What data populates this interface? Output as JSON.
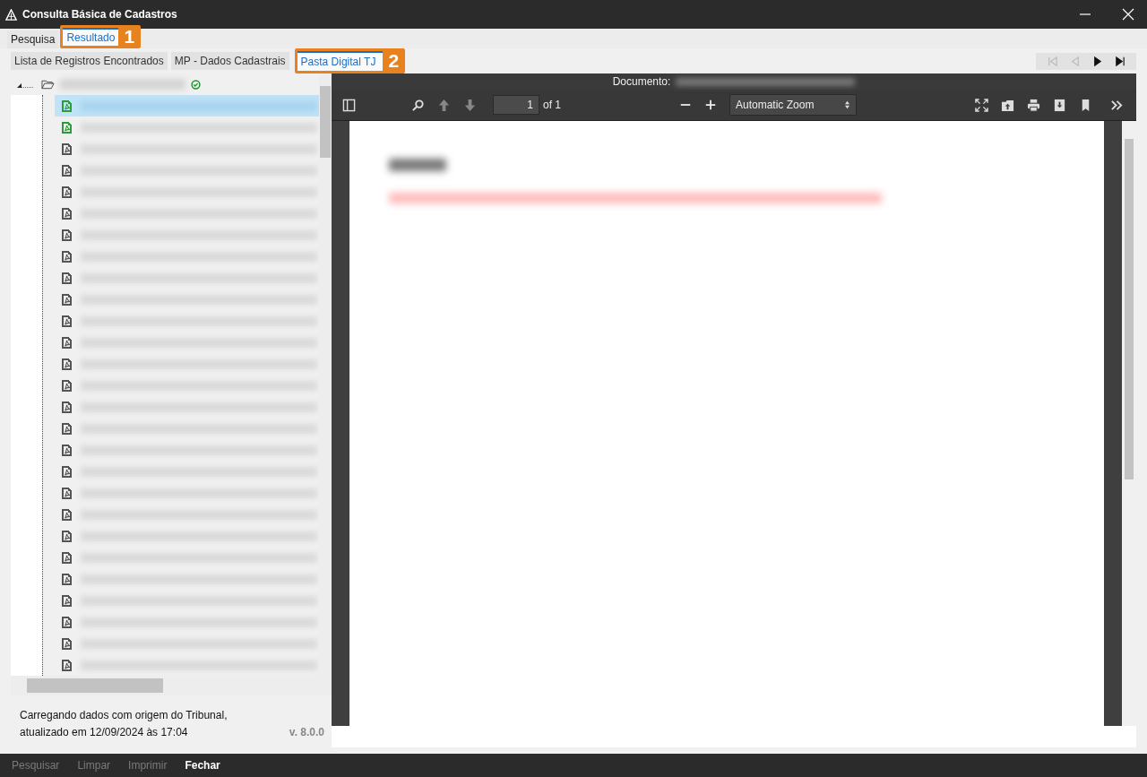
{
  "window": {
    "title": "Consulta Básica de Cadastros"
  },
  "main_tabs": [
    {
      "label": "Pesquisa",
      "selected": false
    },
    {
      "label": "Resultado",
      "selected": true,
      "callout": "1"
    }
  ],
  "sub_tabs": [
    {
      "label": "Lista de Registros Encontrados",
      "selected": false
    },
    {
      "label": "MP - Dados Cadastrais",
      "selected": false
    },
    {
      "label": "Pasta Digital TJ",
      "selected": true,
      "callout": "2"
    }
  ],
  "record_nav": [
    {
      "kind": "first",
      "disabled": true
    },
    {
      "kind": "prev",
      "disabled": true
    },
    {
      "kind": "next",
      "disabled": false
    },
    {
      "kind": "last",
      "disabled": false
    }
  ],
  "tree": {
    "items": [
      {
        "color": "#2e9a3e",
        "selected": true
      },
      {
        "color": "#2e9a3e",
        "selected": false
      },
      {
        "color": "#555555",
        "selected": false
      },
      {
        "color": "#555555",
        "selected": false
      },
      {
        "color": "#555555",
        "selected": false
      },
      {
        "color": "#555555",
        "selected": false
      },
      {
        "color": "#555555",
        "selected": false
      },
      {
        "color": "#555555",
        "selected": false
      },
      {
        "color": "#555555",
        "selected": false
      },
      {
        "color": "#555555",
        "selected": false
      },
      {
        "color": "#555555",
        "selected": false
      },
      {
        "color": "#555555",
        "selected": false
      },
      {
        "color": "#555555",
        "selected": false
      },
      {
        "color": "#555555",
        "selected": false
      },
      {
        "color": "#555555",
        "selected": false
      },
      {
        "color": "#555555",
        "selected": false
      },
      {
        "color": "#555555",
        "selected": false
      },
      {
        "color": "#555555",
        "selected": false
      },
      {
        "color": "#555555",
        "selected": false
      },
      {
        "color": "#555555",
        "selected": false
      },
      {
        "color": "#555555",
        "selected": false
      },
      {
        "color": "#555555",
        "selected": false
      },
      {
        "color": "#555555",
        "selected": false
      },
      {
        "color": "#555555",
        "selected": false
      },
      {
        "color": "#555555",
        "selected": false
      },
      {
        "color": "#555555",
        "selected": false
      },
      {
        "color": "#555555",
        "selected": false
      }
    ]
  },
  "status": {
    "lines": [
      "Carregando dados com origem do Tribunal,",
      "atualizado em 12/09/2024 às 17:04"
    ],
    "version": "v. 8.0.0"
  },
  "viewer": {
    "document_label": "Documento:",
    "page": "1",
    "page_count": "of 1",
    "zoom": "Automatic Zoom"
  },
  "bottom_buttons": [
    {
      "label": "Pesquisar",
      "disabled": true
    },
    {
      "label": "Limpar",
      "disabled": true
    },
    {
      "label": "Imprimir",
      "disabled": true
    },
    {
      "label": "Fechar",
      "disabled": false
    }
  ]
}
